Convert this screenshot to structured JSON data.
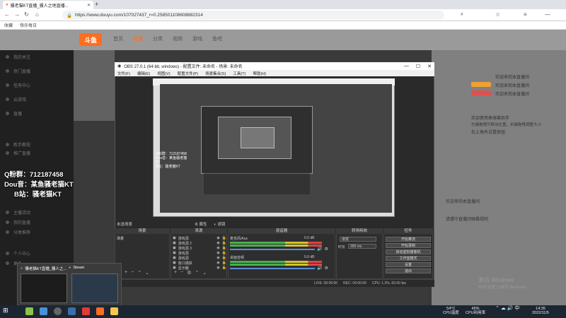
{
  "browser": {
    "tab_title": "骚老猫KT直播_骚人之地直播...",
    "url": "https://www.douyu.com/107027437_r=0.258501108608882314",
    "bookmarks": [
      "收藏",
      "快乐每日"
    ]
  },
  "site": {
    "logo": "斗鱼",
    "nav": [
      "首页",
      "直播",
      "分类",
      "视频",
      "游戏",
      "鱼吧"
    ],
    "sidebar_items": [
      "我的关注",
      "热门直播",
      "任务中心",
      "云游戏",
      "直播",
      "新手教程",
      "推广直播",
      "主播活动",
      "我的直播",
      "分类推荐",
      "个人中心",
      "更多"
    ],
    "overlay_lines": [
      "Q粉群：712187458",
      "Dou音：某鱼骚老猫KT",
      "B站：骚老猫KT"
    ],
    "chat": [
      "欢迎来到本直播间",
      "欢迎来到本直播间",
      "欢迎来到本直播间",
      "欢迎使用鱼弹幕助手",
      "左键拖拽可移动位置，右键拖拽调整大小",
      "右上角有设置按钮",
      "欢迎来到本直播间",
      "请遵守直播间弹幕规则"
    ],
    "windows_watermark": "激活 Windows",
    "windows_watermark_sub": "转到\"设置\"以激活 Windows。"
  },
  "obs": {
    "title": "OBS 27.0.1 (64-bit, windows) - 配置文件: 未命名 - 场景: 未命名",
    "menu": [
      "文件(F)",
      "编辑(E)",
      "视图(V)",
      "配置文件(P)",
      "场景集合(S)",
      "工具(T)",
      "帮助(H)"
    ],
    "scene_label": "未选场景",
    "panels": {
      "scenes": "场景",
      "sources": "来源",
      "mixer": "混音器",
      "transitions": "转场特效",
      "controls": "控件"
    },
    "filter_buttons": [
      "属性",
      "滤镜"
    ],
    "scene_items": [
      "场景"
    ],
    "sources": [
      "游戏源",
      "游戏源 2",
      "游戏源 3",
      "游戏源",
      "游戏源",
      "窗口捕获",
      "显示器"
    ],
    "mixer": {
      "track1_name": "麦克风/Aux",
      "track1_db": "0.0 dB",
      "track2_name": "桌面音频",
      "track2_db": "0.0 dB"
    },
    "transition": {
      "type": "渐变",
      "duration_label": "时长",
      "duration": "300 ms"
    },
    "controls": [
      "开始推流",
      "开始录制",
      "启动虚拟摄像机",
      "工作室模式",
      "设置",
      "退出"
    ],
    "status": [
      "LIVE: 00:00:00",
      "REC: 00:00:00",
      "CPU: 1.3%, 60.00 fps"
    ],
    "preview_text": [
      "Q粉群：712187458",
      "Dou音：某鱼骚老猫KT",
      "B站：骚老猫KT"
    ]
  },
  "taskbar_popup": {
    "items": [
      "骚老猫KT直播_骚人之...",
      "Steam"
    ]
  },
  "taskbar": {
    "temp": "54°C",
    "temp_label": "CPU温度",
    "cpu": "45%",
    "cpu_label": "CPU利用率",
    "time": "14:35",
    "date": "2022/11/5"
  },
  "accent": "#ff6d1f"
}
